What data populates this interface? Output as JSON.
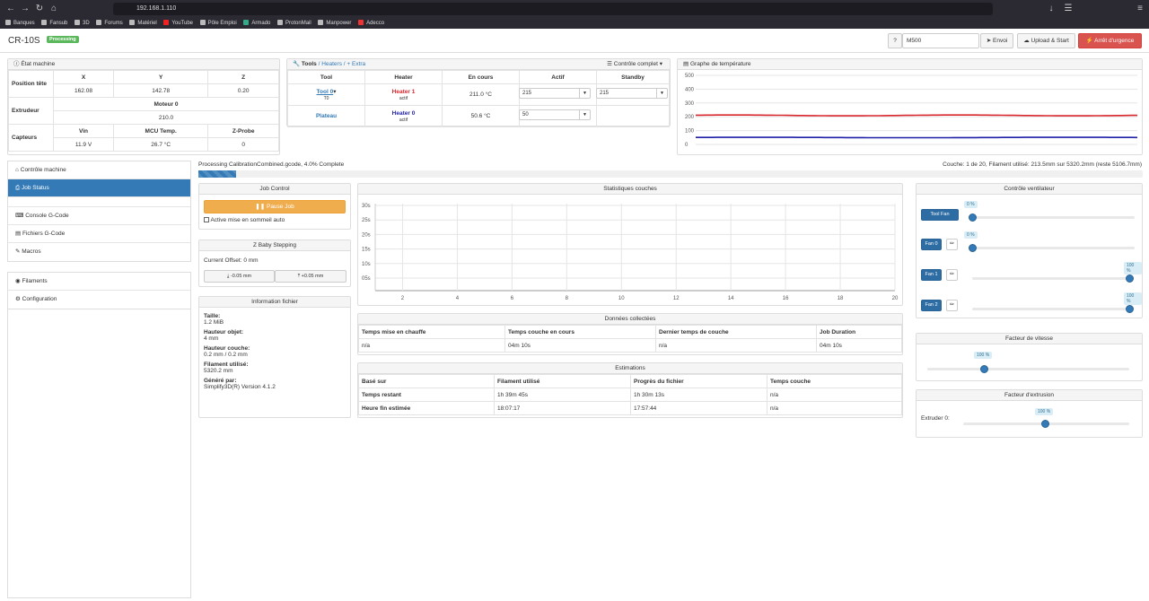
{
  "browser": {
    "url": "192.168.1.110",
    "bookmarks": [
      "Banques",
      "Fansub",
      "3D",
      "Forums",
      "Matériel",
      "YouTube",
      "Pôle Emploi",
      "Armado",
      "ProtonMail",
      "Manpower",
      "Adecco"
    ]
  },
  "header": {
    "title": "CR-10S",
    "status": "Processing",
    "help": "?",
    "gcode_input": "M500",
    "send": "Envoi",
    "upload": "Upload & Start",
    "emergency": "Arrêt d'urgence"
  },
  "machine": {
    "title": "État machine",
    "head_label": "Position tête",
    "x_h": "X",
    "y_h": "Y",
    "z_h": "Z",
    "x": "162.08",
    "y": "142.78",
    "z": "0.20",
    "extruder_label": "Extrudeur",
    "motor_h": "Moteur 0",
    "motor": "210.0",
    "sensors_label": "Capteurs",
    "vin_h": "Vin",
    "mcu_h": "MCU Temp.",
    "zprobe_h": "Z-Probe",
    "vin": "11.9 V",
    "mcu": "26.7 °C",
    "zprobe": "0"
  },
  "tools": {
    "title": "Tools",
    "heaters": "Heaters",
    "extra": "Extra",
    "control": "Contrôle complet",
    "h_tool": "Tool",
    "h_heater": "Heater",
    "h_current": "En cours",
    "h_active": "Actif",
    "h_standby": "Standby",
    "rows": [
      {
        "tool": "Tool 0",
        "tool_sub": "T0",
        "heater": "Heater 1",
        "state": "actif",
        "current": "211.0 °C",
        "active": "215",
        "standby": "215"
      },
      {
        "tool": "Plateau",
        "heater": "Heater 0",
        "state": "actif",
        "current": "50.6 °C",
        "active": "50"
      }
    ]
  },
  "temp_graph": {
    "title": "Graphe de température",
    "yticks": [
      "500",
      "400",
      "300",
      "200",
      "100",
      "0"
    ]
  },
  "sidebar": {
    "items": [
      "Contrôle machine",
      "Job Status",
      "Console G-Code",
      "Fichiers G-Code",
      "Macros",
      "Filaments",
      "Configuration"
    ]
  },
  "progress": {
    "left": "Processing CalibrationCombined.gcode, 4.0% Complete",
    "right": "Couche: 1 de 20, Filament utilisé: 213.5mm sur 5320.2mm (reste 5106.7mm)",
    "percent": 4.0
  },
  "job_control": {
    "title": "Job Control",
    "pause": "Pause Job",
    "sleep": "Active mise en sommeil auto"
  },
  "baby": {
    "title": "Z Baby Stepping",
    "offset": "Current Offset: 0 mm",
    "minus": "-0.05 mm",
    "plus": "+0.05 mm"
  },
  "file_info": {
    "title": "Information fichier",
    "size_l": "Taille:",
    "size": "1.2 MiB",
    "height_l": "Hauteur objet:",
    "height": "4 mm",
    "layer_l": "Hauteur couche:",
    "layer": "0.2 mm / 0.2 mm",
    "fil_l": "Filament utilisé:",
    "fil": "5320.2 mm",
    "gen_l": "Généré par:",
    "gen": "Simplify3D(R) Version 4.1.2"
  },
  "layer_stats": {
    "title": "Statistiques couches",
    "yticks": [
      "30s",
      "25s",
      "20s",
      "15s",
      "10s",
      "05s"
    ],
    "xticks": [
      "2",
      "4",
      "6",
      "8",
      "10",
      "12",
      "14",
      "16",
      "18",
      "20"
    ]
  },
  "collected": {
    "title": "Données collectées",
    "headers": [
      "Temps mise en chauffe",
      "Temps couche en cours",
      "Dernier temps de couche",
      "Job Duration"
    ],
    "values": [
      "n/a",
      "04m 10s",
      "n/a",
      "04m 10s"
    ]
  },
  "estimations": {
    "title": "Estimations",
    "headers": [
      "Basé sur",
      "Filament utilisé",
      "Progrès du fichier",
      "Temps couche"
    ],
    "rows": [
      [
        "Temps restant",
        "1h 39m 45s",
        "1h 30m 13s",
        "n/a"
      ],
      [
        "Heure fin estimée",
        "18:07:17",
        "17:57:44",
        "n/a"
      ]
    ]
  },
  "fans": {
    "title": "Contrôle ventilateur",
    "items": [
      {
        "name": "Tool Fan",
        "value": "0 %",
        "level": 0
      },
      {
        "name": "Fan 0",
        "value": "0 %",
        "level": 0
      },
      {
        "name": "Fan 1",
        "value": "100 %",
        "level": 100
      },
      {
        "name": "Fan 2",
        "value": "100 %",
        "level": 100
      }
    ]
  },
  "speed": {
    "title": "Facteur de vitesse",
    "value": "100 %",
    "level": 100
  },
  "extrusion": {
    "title": "Facteur d'extrusion",
    "label": "Extruder 0:",
    "value": "100 %",
    "level": 100
  },
  "colors": {
    "accent": "#337ab7",
    "danger": "#d9534f",
    "warning": "#f0ad4e",
    "success": "#5cb85c",
    "heater_red": "#d9272e",
    "heater_blue": "#1f1fa8"
  }
}
